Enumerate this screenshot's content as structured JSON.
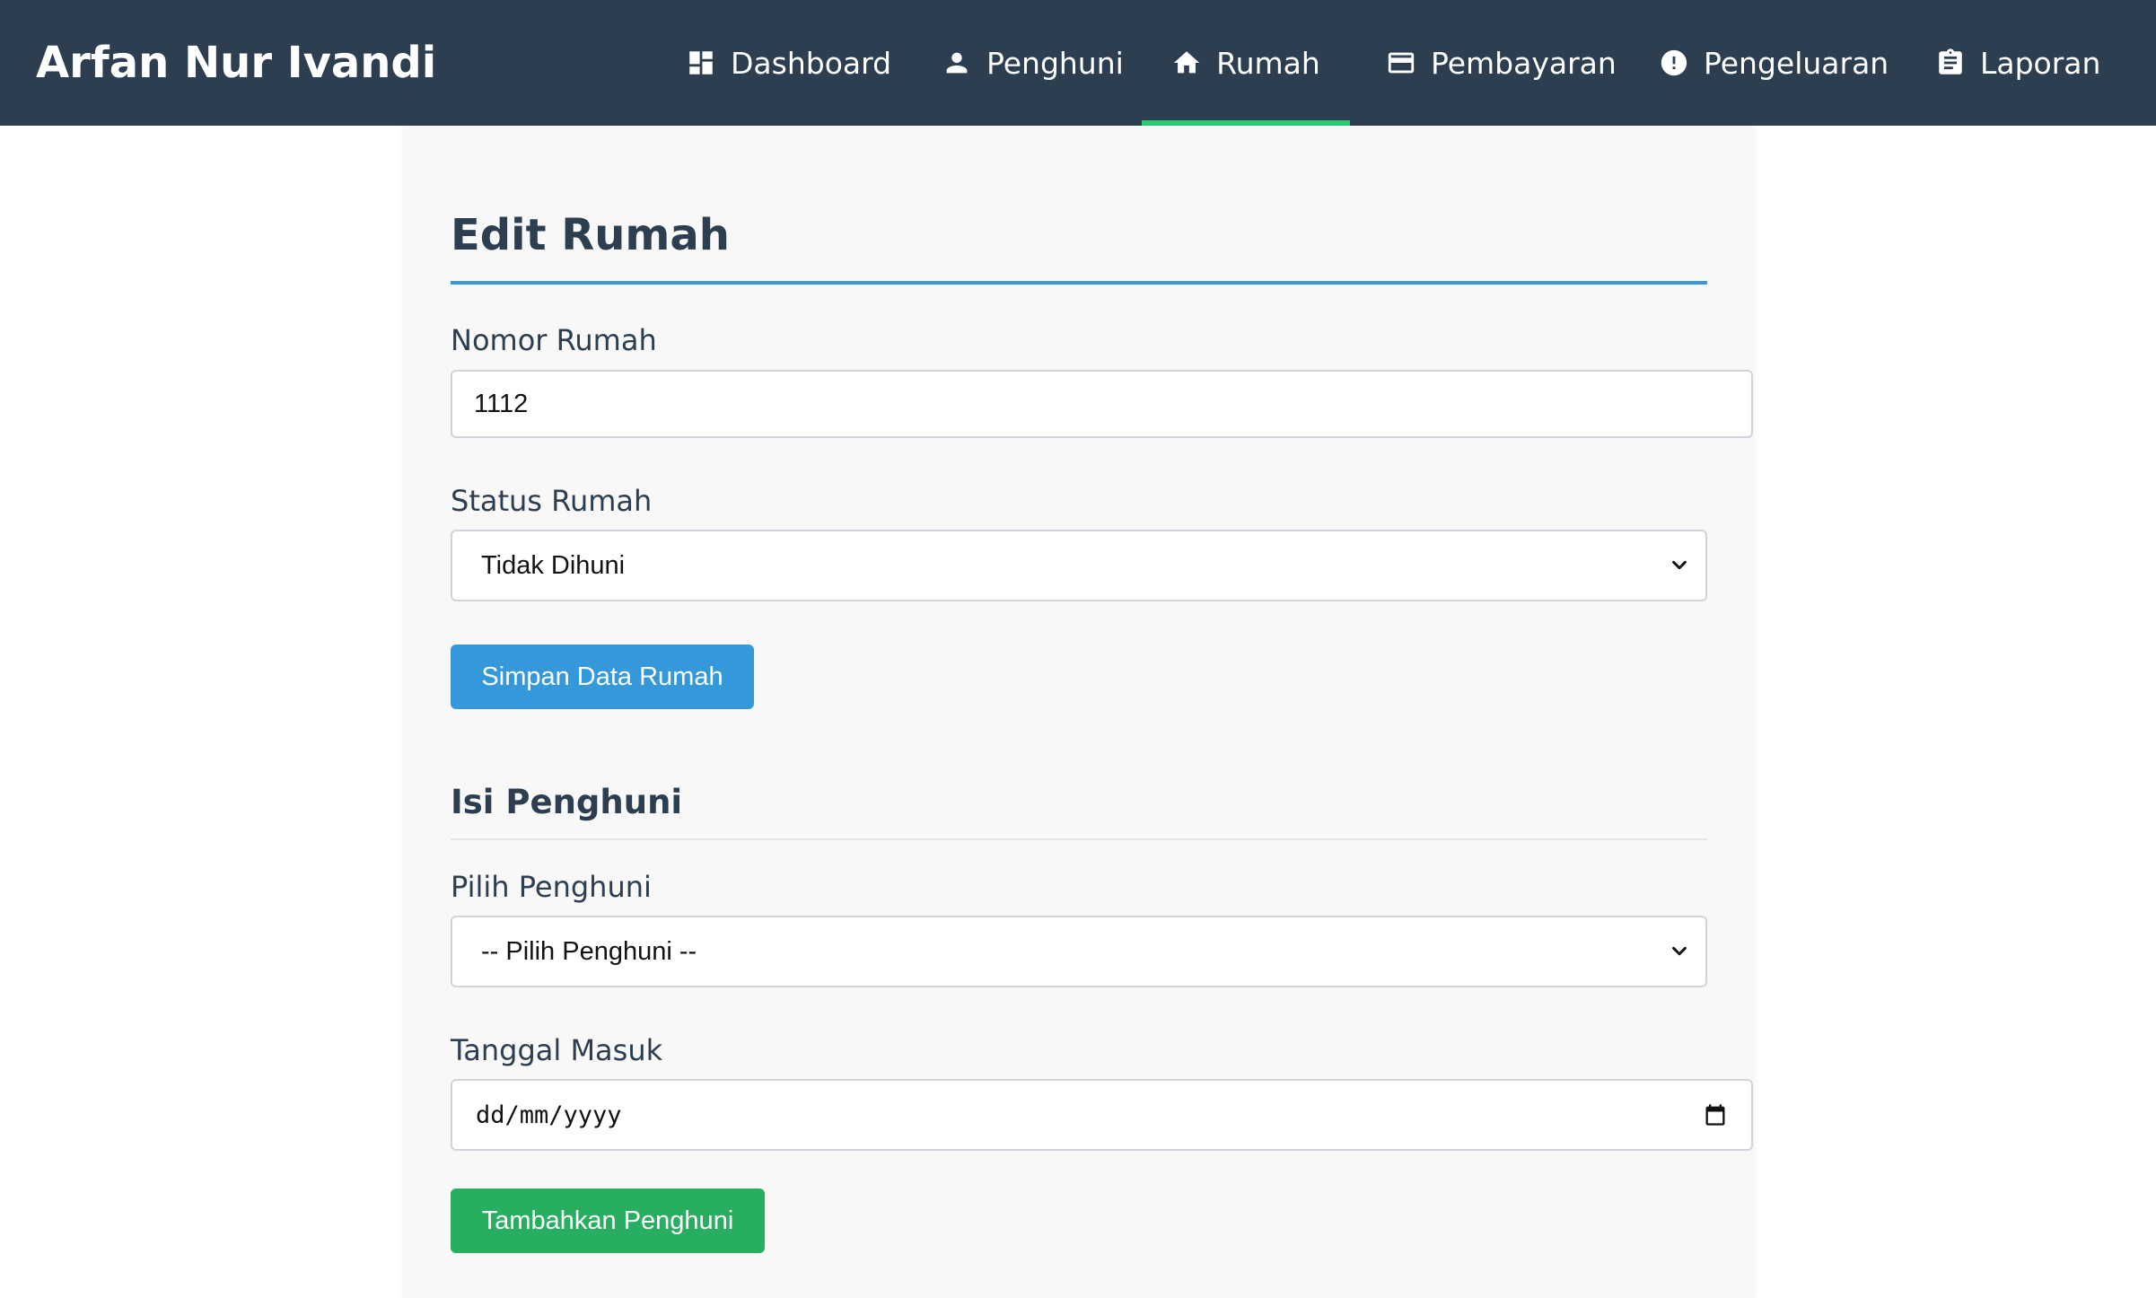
{
  "header": {
    "brand": "Arfan Nur Ivandi",
    "nav": [
      {
        "label": "Dashboard",
        "icon": "dashboard-icon"
      },
      {
        "label": "Penghuni",
        "icon": "person-icon"
      },
      {
        "label": "Rumah",
        "icon": "home-icon",
        "active": true
      },
      {
        "label": "Pembayaran",
        "icon": "credit-card-icon"
      },
      {
        "label": "Pengeluaran",
        "icon": "alert-circle-icon"
      },
      {
        "label": "Laporan",
        "icon": "clipboard-icon"
      }
    ]
  },
  "form": {
    "title": "Edit Rumah",
    "nomor_label": "Nomor Rumah",
    "nomor_value": "1112",
    "status_label": "Status Rumah",
    "status_value": "Tidak Dihuni",
    "save_label": "Simpan Data Rumah"
  },
  "resident": {
    "title": "Isi Penghuni",
    "pilih_label": "Pilih Penghuni",
    "pilih_value": "-- Pilih Penghuni --",
    "tanggal_label": "Tanggal Masuk",
    "tanggal_placeholder": "dd/mm/yyyy",
    "add_label": "Tambahkan Penghuni"
  },
  "colors": {
    "navbar": "#2c3e50",
    "active_indicator": "#2ecc71",
    "primary": "#3498db",
    "success": "#27ae60"
  }
}
